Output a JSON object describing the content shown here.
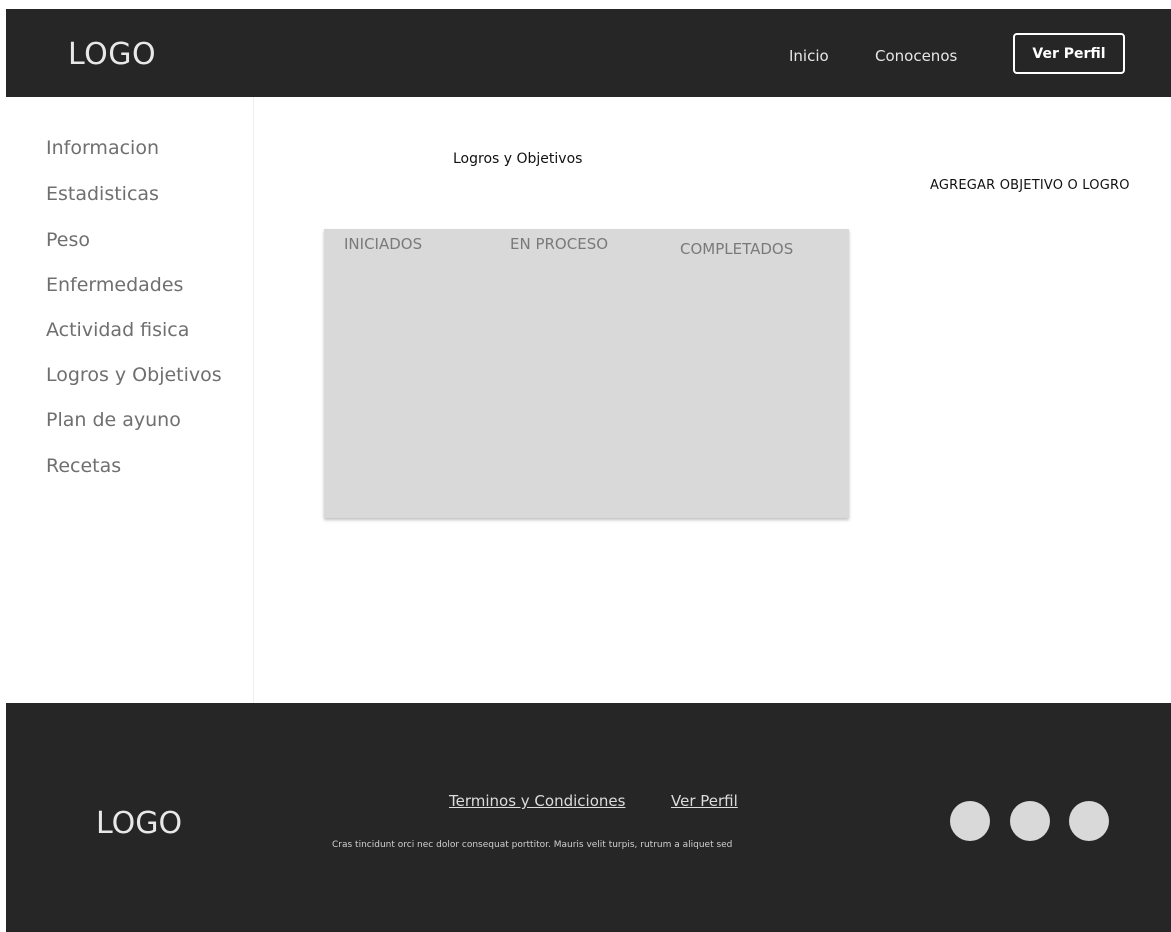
{
  "header": {
    "logo": "LOGO",
    "nav": {
      "inicio": "Inicio",
      "conocenos": "Conocenos"
    },
    "profile_button": "Ver Perfil"
  },
  "sidebar": {
    "items": [
      {
        "label": "Informacion"
      },
      {
        "label": "Estadisticas"
      },
      {
        "label": "Peso"
      },
      {
        "label": "Enfermedades"
      },
      {
        "label": "Actividad fisica"
      },
      {
        "label": "Logros y Objetivos"
      },
      {
        "label": "Plan de ayuno"
      },
      {
        "label": "Recetas"
      }
    ]
  },
  "main": {
    "title": "Logros y Objetivos",
    "add_action": "AGREGAR OBJETIVO O LOGRO",
    "board": {
      "columns": [
        {
          "label": "INICIADOS"
        },
        {
          "label": "EN PROCESO"
        },
        {
          "label": "COMPLETADOS"
        }
      ]
    }
  },
  "footer": {
    "logo": "LOGO",
    "links": {
      "terms": "Terminos y Condiciones",
      "profile": "Ver Perfil"
    },
    "text": "Cras tincidunt orci nec dolor consequat porttitor. Mauris velit turpis, rutrum a aliquet sed",
    "social_count": 3
  },
  "colors": {
    "dark": "#262626",
    "panel": "#d9d9d9",
    "muted_text": "#6f6f6f"
  }
}
